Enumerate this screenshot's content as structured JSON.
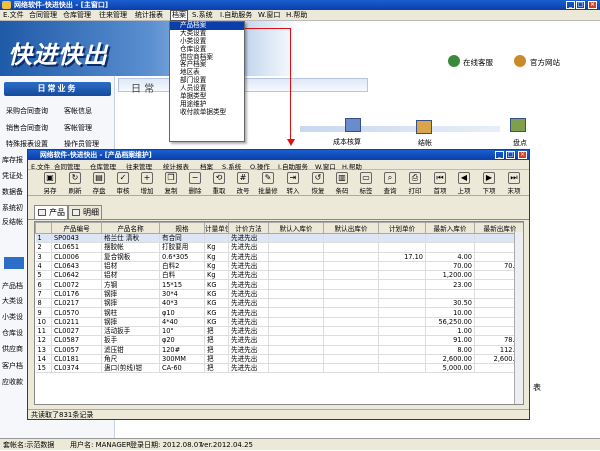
{
  "main_window": {
    "title": "网络软件-快进快出 - [主窗口]",
    "menu": [
      "E.文件",
      "合同管理",
      "仓库管理",
      "往来管理",
      "统计报表",
      "档案",
      "S.系统",
      "I.自助服务",
      "W.窗口",
      "H.帮助"
    ]
  },
  "banner": {
    "logo": "快进快出",
    "online_service": "在线客服",
    "official_site": "官方网站"
  },
  "sidebar": {
    "title": "日常业务",
    "items": [
      [
        "采购合同查询",
        "客帐信息"
      ],
      [
        "销售合同查询",
        "客帐管理"
      ],
      [
        "特殊报表设置",
        "操作员管理"
      ]
    ],
    "side_labels": [
      "库存报",
      "凭证处",
      "数据备",
      "系统初",
      "反结帐",
      "产品档",
      "大类设",
      "小类设",
      "仓库设",
      "供应商",
      "客户档",
      "应收款"
    ]
  },
  "main_panel": {
    "tab_label": "日 常",
    "flow_labels": [
      "成本核算",
      "结帐",
      "盘点"
    ],
    "right_fragment": "表"
  },
  "dropdown": {
    "items": [
      "产品档案",
      "大类设置",
      "小类设置",
      "仓库设置",
      "供应商档案",
      "客户档案",
      "地区表",
      "部门设置",
      "人员设置",
      "单据类型",
      "用途维护",
      "收付款单据类型"
    ]
  },
  "child_window": {
    "title": "网络软件-快进快出 - [产品档案维护]",
    "menu": [
      "E.文件",
      "合同管理",
      "仓库管理",
      "往来管理",
      "统计报表",
      "档案",
      "S.系统",
      "O.操作",
      "I.自助服务",
      "W.窗口",
      "H.帮助"
    ],
    "toolbar": [
      "另存",
      "刷新",
      "存盘",
      "审核",
      "增加",
      "复制",
      "删除",
      "重取",
      "改号",
      "批量修",
      "转入",
      "恢复",
      "条码",
      "标签",
      "查询",
      "打印",
      "首项",
      "上项",
      "下项",
      "末项"
    ],
    "tabs": [
      "产品",
      "明细"
    ],
    "columns": [
      "产品编号",
      "产品名称",
      "规格",
      "计量单位",
      "计价方法",
      "默认入库价",
      "默认出库价",
      "计划单价",
      "最新入库价",
      "最新出库价"
    ],
    "rows": [
      [
        "1",
        "SP0043",
        "格兰仕 清秋",
        "有合同",
        "",
        "先进先出",
        "",
        "",
        "",
        "",
        ""
      ],
      [
        "2",
        "CL0651",
        "摆胶帐",
        "打胶要用",
        "Kg",
        "先进先出",
        "",
        "",
        "",
        "",
        ""
      ],
      [
        "3",
        "CL0006",
        "复合钢板",
        "0.6*305",
        "Kg",
        "先进先出",
        "",
        "",
        "17.10",
        "4.00",
        ""
      ],
      [
        "4",
        "CL0643",
        "铝材",
        "白料2",
        "Kg",
        "先进先出",
        "",
        "",
        "",
        "70.00",
        "70.00"
      ],
      [
        "5",
        "CL0642",
        "铝材",
        "白料",
        "Kg",
        "先进先出",
        "",
        "",
        "",
        "1,200.00",
        ""
      ],
      [
        "6",
        "CL0072",
        "方钢",
        "15*15",
        "KG",
        "先进先出",
        "",
        "",
        "",
        "23.00",
        ""
      ],
      [
        "7",
        "CL0176",
        "钢摔",
        "30*4",
        "KG",
        "先进先出",
        "",
        "",
        "",
        "",
        ""
      ],
      [
        "8",
        "CL0217",
        "钢摔",
        "40*3",
        "KG",
        "先进先出",
        "",
        "",
        "",
        "30.50",
        ""
      ],
      [
        "9",
        "CL0570",
        "钢柱",
        "φ10",
        "KG",
        "先进先出",
        "",
        "",
        "",
        "10.00",
        ""
      ],
      [
        "10",
        "CL0211",
        "钢摔",
        "4*40",
        "KG",
        "先进先出",
        "",
        "",
        "",
        "56,250.00",
        ""
      ],
      [
        "11",
        "CL0027",
        "活动扳手",
        "10\"",
        "把",
        "先进先出",
        "",
        "",
        "",
        "1.00",
        ""
      ],
      [
        "12",
        "CL0587",
        "扳手",
        "φ20",
        "把",
        "先进先出",
        "",
        "",
        "",
        "91.00",
        "78.00"
      ],
      [
        "13",
        "CL0057",
        "滤压钳",
        "120#",
        "把",
        "先进先出",
        "",
        "",
        "",
        "8.00",
        "112.00"
      ],
      [
        "14",
        "CL0181",
        "角尺",
        "300MM",
        "把",
        "先进先出",
        "",
        "",
        "",
        "2,600.00",
        "2,600.00"
      ],
      [
        "15",
        "CL0374",
        "蛊口(剪线)钳",
        "CA-60",
        "把",
        "先进先出",
        "",
        "",
        "",
        "5,000.00",
        ""
      ]
    ],
    "status": "共读取了831条记录"
  },
  "statusbar": {
    "account": "套帐名:示范数据",
    "user": "用户名: MANAGER",
    "login_date": "登录日期: 2012.08.07",
    "version": "ver.2012.04.25"
  }
}
